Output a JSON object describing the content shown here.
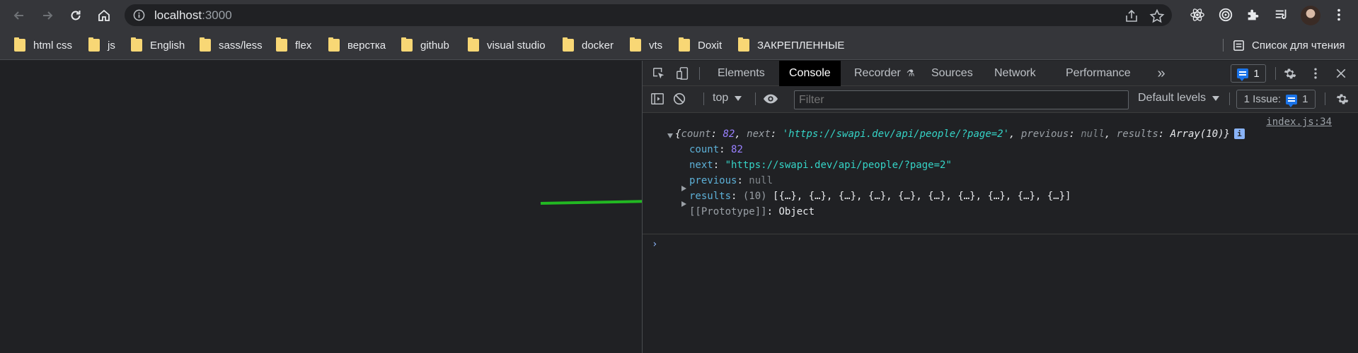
{
  "browser": {
    "url_host": "localhost",
    "url_port": ":3000",
    "bookmarks": [
      "html css",
      "js",
      "English",
      "sass/less",
      "flex",
      "верстка",
      "github",
      "visual studio",
      "docker",
      "vts",
      "Doxit",
      "ЗАКРЕПЛЕННЫЕ"
    ],
    "reading_list": "Список для чтения"
  },
  "devtools": {
    "tabs": [
      "Elements",
      "Console",
      "Recorder",
      "Sources",
      "Network",
      "Performance"
    ],
    "active_tab": "Console",
    "messages_badge": "1",
    "context": "top",
    "filter_placeholder": "Filter",
    "levels": "Default levels",
    "issues": "1 Issue:",
    "issues_count": "1"
  },
  "console": {
    "source": "index.js:34",
    "summary": {
      "open": "{",
      "count_key": "count",
      "count_val": "82",
      "next_key": "next",
      "next_val": "'https://swapi.dev/api/people/?page=2'",
      "previous_key": "previous",
      "previous_val": "null",
      "results_key": "results",
      "results_val": "Array(10)",
      "close": "}"
    },
    "props": {
      "count_key": "count",
      "count_val": "82",
      "next_key": "next",
      "next_val": "\"https://swapi.dev/api/people/?page=2\"",
      "previous_key": "previous",
      "previous_val": "null",
      "results_key": "results",
      "results_len": "(10)",
      "results_val": "[{…}, {…}, {…}, {…}, {…}, {…}, {…}, {…}, {…}, {…}]",
      "proto_key": "[[Prototype]]",
      "proto_val": "Object"
    },
    "prompt": "›"
  },
  "colors": {
    "accent_blue": "#1a73e8",
    "arrow_green": "#22b822",
    "number": "#9980ff",
    "string": "#35d4c7"
  }
}
